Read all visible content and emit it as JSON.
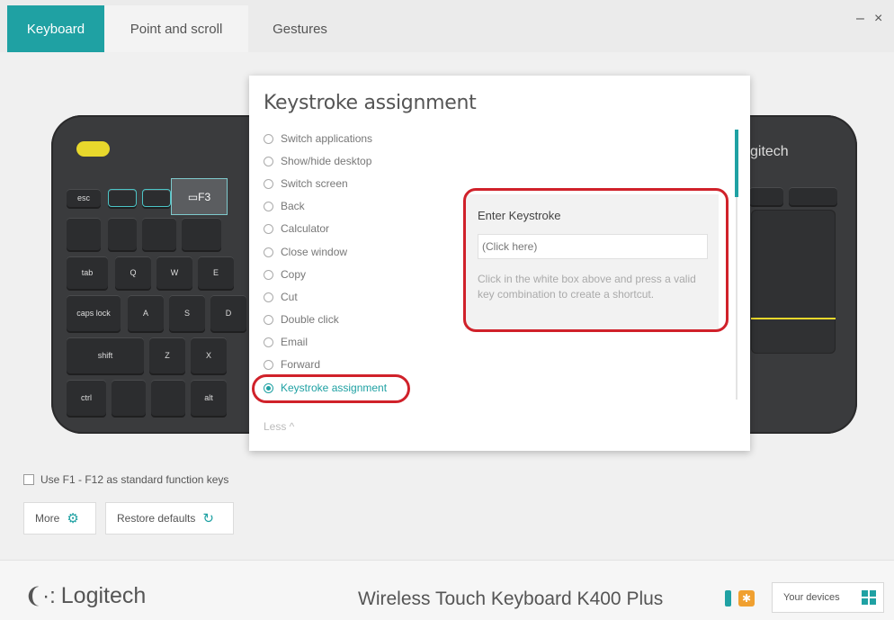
{
  "tabs": [
    {
      "label": "Keyboard",
      "active": true
    },
    {
      "label": "Point and scroll",
      "active": false
    },
    {
      "label": "Gestures",
      "active": false
    }
  ],
  "window": {
    "minimize": "–",
    "close": "×"
  },
  "keyboard_image": {
    "keys_row1": [
      "esc",
      "F3"
    ],
    "keys_row3": [
      "tab",
      "Q",
      "W",
      "E"
    ],
    "keys_row4": [
      "caps lock",
      "A",
      "S",
      "D"
    ],
    "keys_row5": [
      "shift",
      "Z",
      "X"
    ],
    "keys_row6": [
      "ctrl",
      "alt"
    ],
    "logo_text": "gitech",
    "accent_color": "#e8d82c"
  },
  "panel": {
    "title": "Keystroke assignment",
    "options": [
      {
        "label": "Switch applications",
        "selected": false
      },
      {
        "label": "Show/hide desktop",
        "selected": false
      },
      {
        "label": "Switch screen",
        "selected": false
      },
      {
        "label": "Back",
        "selected": false
      },
      {
        "label": "Calculator",
        "selected": false
      },
      {
        "label": "Close window",
        "selected": false
      },
      {
        "label": "Copy",
        "selected": false
      },
      {
        "label": "Cut",
        "selected": false
      },
      {
        "label": "Double click",
        "selected": false
      },
      {
        "label": "Email",
        "selected": false
      },
      {
        "label": "Forward",
        "selected": false
      },
      {
        "label": "Keystroke assignment",
        "selected": true
      }
    ],
    "less_label": "Less ^",
    "keystroke": {
      "label": "Enter Keystroke",
      "placeholder": "(Click here)",
      "help": "Click in the white box above and press a valid key combination to create a shortcut."
    }
  },
  "settings": {
    "fkeys_label": "Use F1 - F12 as standard function keys",
    "fkeys_checked": false,
    "more_label": "More",
    "restore_label": "Restore defaults"
  },
  "footer": {
    "brand": "Logitech",
    "device_name": "Wireless Touch Keyboard K400 Plus",
    "your_devices_label": "Your devices"
  },
  "colors": {
    "accent": "#1fa1a3",
    "highlight": "#d0212a"
  }
}
